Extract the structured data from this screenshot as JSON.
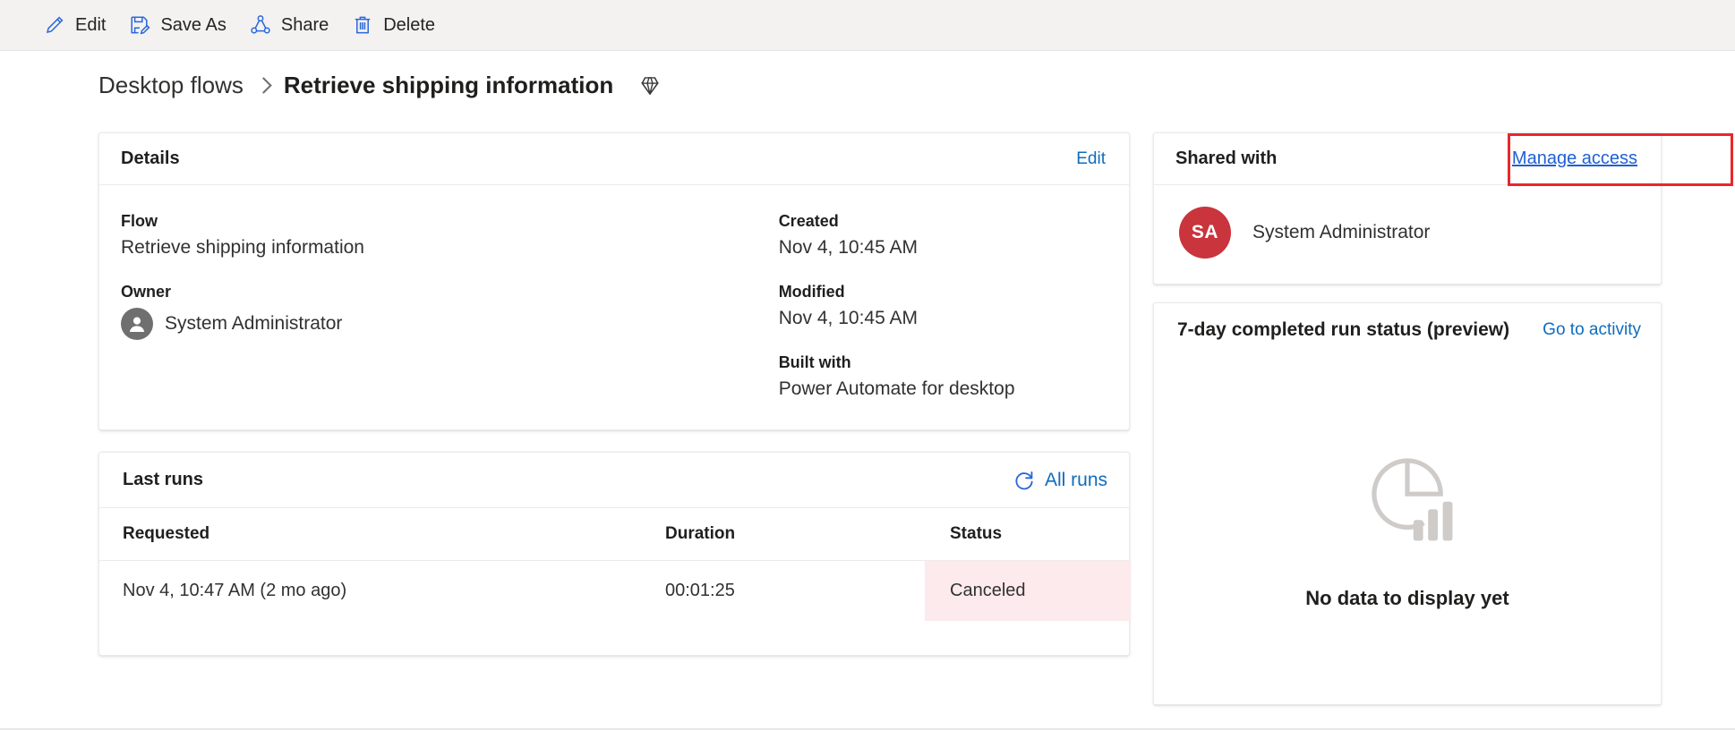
{
  "commandbar": {
    "buttons": [
      {
        "label": "Edit",
        "icon": "pencil-icon"
      },
      {
        "label": "Save As",
        "icon": "save-as-icon"
      },
      {
        "label": "Share",
        "icon": "share-icon"
      },
      {
        "label": "Delete",
        "icon": "trash-icon"
      }
    ]
  },
  "breadcrumb": {
    "parent": "Desktop flows",
    "current": "Retrieve shipping information",
    "badge_icon": "gem-icon"
  },
  "details": {
    "title": "Details",
    "edit_label": "Edit",
    "flow_label": "Flow",
    "flow_value": "Retrieve shipping information",
    "owner_label": "Owner",
    "owner_value": "System Administrator",
    "owner_icon": "person-icon",
    "created_label": "Created",
    "created_value": "Nov 4, 10:45 AM",
    "modified_label": "Modified",
    "modified_value": "Nov 4, 10:45 AM",
    "built_with_label": "Built with",
    "built_with_value": "Power Automate for desktop"
  },
  "last_runs": {
    "title": "Last runs",
    "all_runs_label": "All runs",
    "refresh_icon": "refresh-icon",
    "columns": [
      "Requested",
      "Duration",
      "Status"
    ],
    "rows": [
      {
        "requested": "Nov 4, 10:47 AM (2 mo ago)",
        "duration": "00:01:25",
        "status": "Canceled",
        "status_bg": "#fdeaec"
      }
    ]
  },
  "shared_with": {
    "title": "Shared with",
    "manage_access_label": "Manage access",
    "highlight_color": "#e8272c",
    "people": [
      {
        "initials": "SA",
        "name": "System Administrator",
        "avatar_color": "#c9343d"
      }
    ]
  },
  "run_status": {
    "title": "7-day completed run status (preview)",
    "activity_link_label": "Go to activity",
    "empty_icon": "pie-bar-chart-icon",
    "empty_text": "No data to display yet"
  },
  "colors": {
    "accent_link": "#0f6cbd",
    "command_icon": "#2b66d9",
    "commandbar_bg": "#f3f2f1"
  }
}
